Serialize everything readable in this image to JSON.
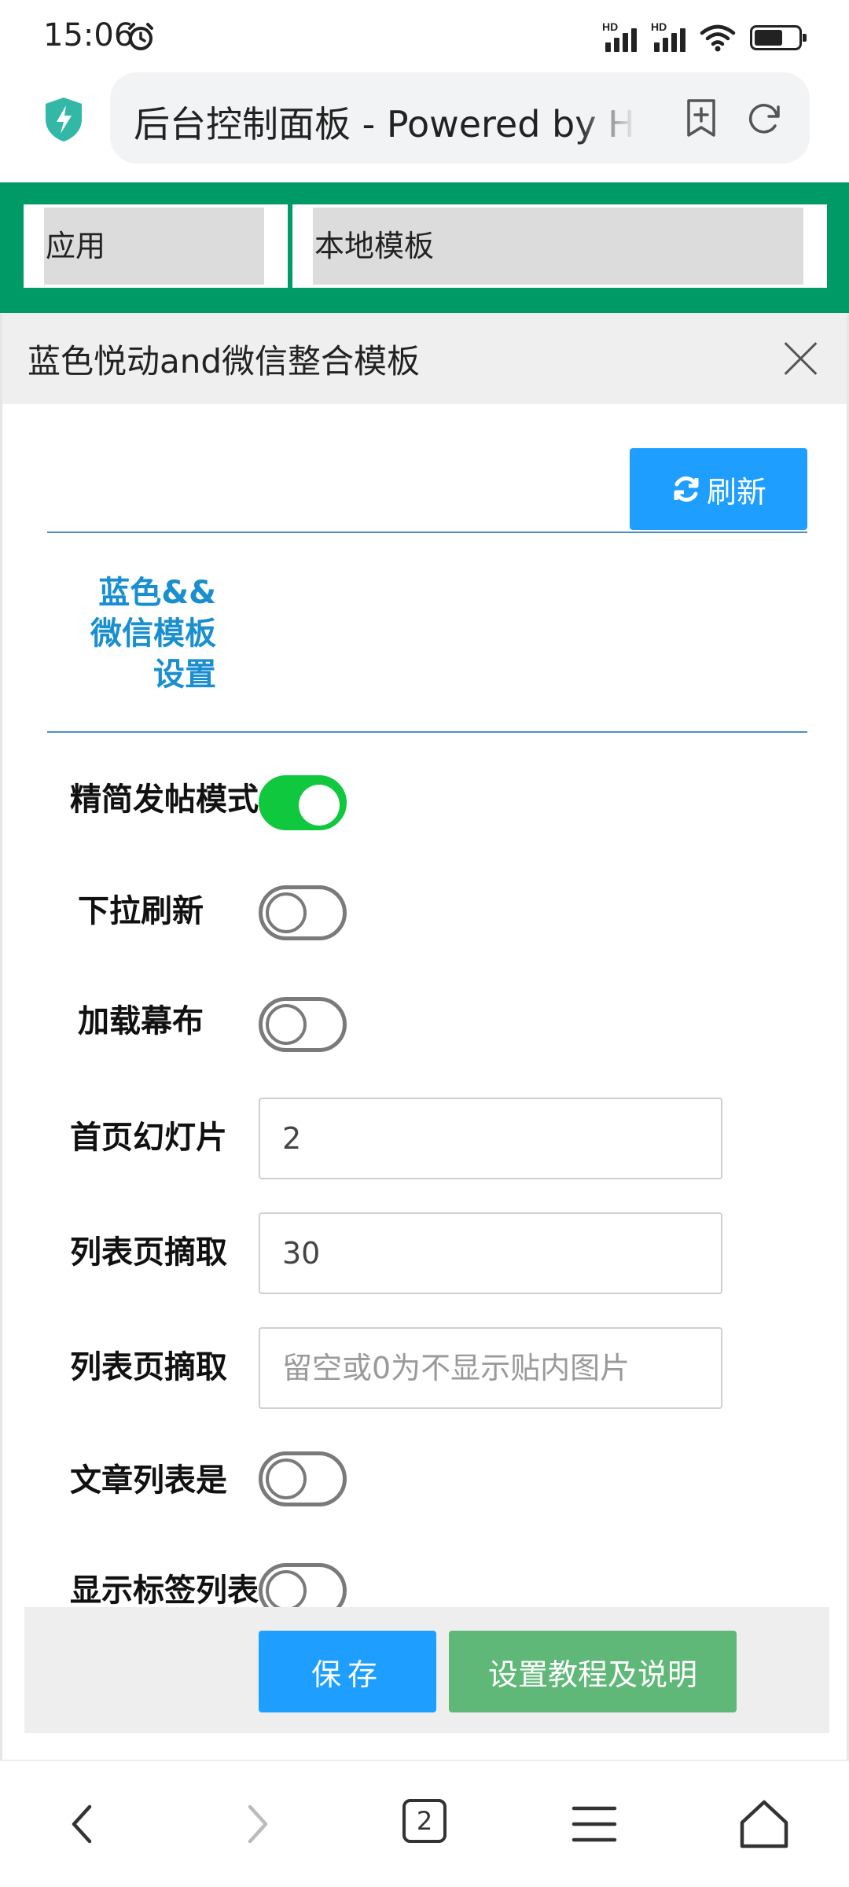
{
  "status_bar": {
    "time": "15:06",
    "icons": [
      "alarm-icon",
      "hd-signal-icon",
      "hd-signal-icon",
      "wifi-icon",
      "battery-icon"
    ],
    "hd_label": "HD"
  },
  "browser": {
    "url_title": "后台控制面板 - Powered by H",
    "icons": [
      "shield-icon",
      "bookmark-add-icon",
      "reload-icon"
    ]
  },
  "header": {
    "tabs": [
      {
        "label": "应用"
      },
      {
        "label": "本地模板"
      }
    ],
    "accent_color": "#009a66"
  },
  "dialog": {
    "title": "蓝色悦动and微信整合模板",
    "refresh_label": "刷新",
    "section_title_lines": [
      "蓝色&&",
      "微信模板",
      "设置"
    ],
    "settings": [
      {
        "label": "精简发帖模式",
        "type": "toggle",
        "checked": true
      },
      {
        "label": "下拉刷新",
        "type": "toggle",
        "checked": false
      },
      {
        "label": "加载幕布",
        "type": "toggle",
        "checked": false
      },
      {
        "label": "首页幻灯片",
        "type": "input",
        "value": "2",
        "placeholder": ""
      },
      {
        "label": "列表页摘取",
        "type": "input",
        "value": "30",
        "placeholder": ""
      },
      {
        "label": "列表页摘取",
        "type": "input",
        "value": "",
        "placeholder": "留空或0为不显示贴内图片"
      },
      {
        "label": "文章列表是",
        "type": "toggle",
        "checked": false
      },
      {
        "label": "显示标签列表",
        "type": "toggle",
        "checked": false
      }
    ],
    "footer": {
      "save_label": "保存",
      "guide_label": "设置教程及说明"
    },
    "colors": {
      "primary": "#1e9fff",
      "success": "#5fb878",
      "toggle_on": "#10c83e",
      "section_title": "#1a8fd0"
    }
  },
  "bottom_nav": {
    "tab_count": "2",
    "icons": [
      "back-icon",
      "forward-icon",
      "tabs-icon",
      "menu-icon",
      "home-icon"
    ]
  }
}
